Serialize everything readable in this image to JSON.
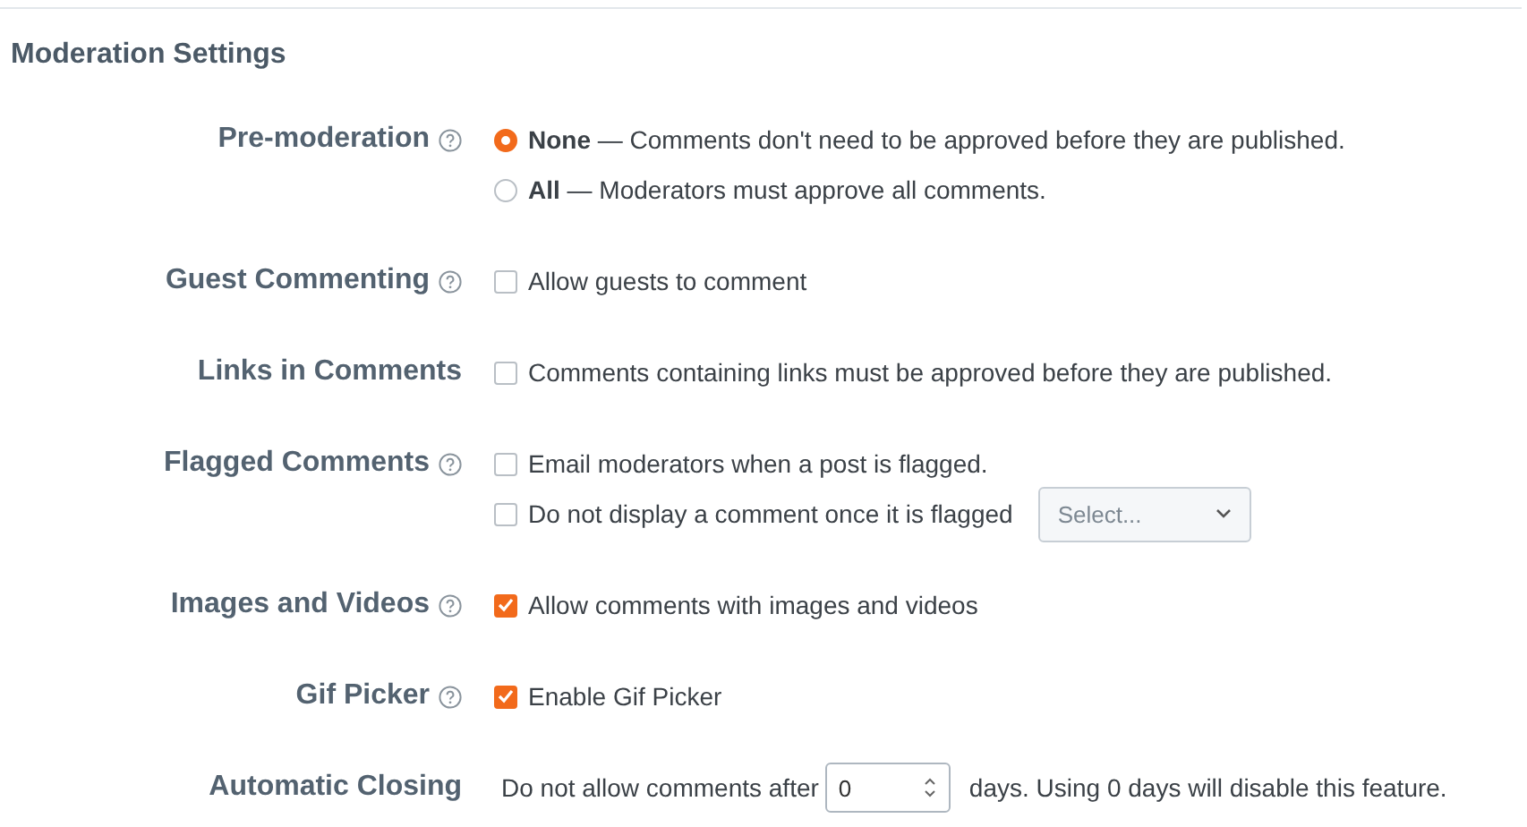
{
  "title": "Moderation Settings",
  "settings": [
    {
      "label": "Pre-moderation",
      "help": true,
      "options": [
        {
          "kind": "radio",
          "text": "**None** — Comments don't need to be approved before they are published.",
          "selected": true
        },
        {
          "kind": "radio",
          "text": "**All** — Moderators must approve all comments.",
          "selected": false
        }
      ]
    },
    {
      "label": "Guest Commenting",
      "help": true,
      "options": [
        {
          "kind": "checkbox",
          "text": "Allow guests to comment",
          "checked": false
        }
      ]
    },
    {
      "label": "Links in Comments",
      "help": false,
      "options": [
        {
          "kind": "checkbox",
          "text": "Comments containing links must be approved before they are published.",
          "checked": false
        }
      ]
    },
    {
      "label": "Flagged Comments",
      "help": true,
      "options": [
        {
          "kind": "checkbox",
          "text": "Email moderators when a post is flagged.",
          "checked": false
        },
        {
          "kind": "checkbox",
          "text": "Do not display a comment once it is flagged",
          "checked": false,
          "select": {
            "placeholder": "Select..."
          }
        }
      ]
    },
    {
      "label": "Images and Videos",
      "help": true,
      "options": [
        {
          "kind": "checkbox",
          "text": "Allow comments with images and videos",
          "checked": true
        }
      ]
    },
    {
      "label": "Gif Picker",
      "help": true,
      "options": [
        {
          "kind": "checkbox",
          "text": "Enable Gif Picker",
          "checked": true
        }
      ]
    },
    {
      "label": "Automatic Closing",
      "help": false,
      "options": [
        {
          "kind": "number",
          "before": "Do not allow comments after",
          "value": "0",
          "after": "days. Using 0 days will disable this feature."
        }
      ]
    }
  ]
}
